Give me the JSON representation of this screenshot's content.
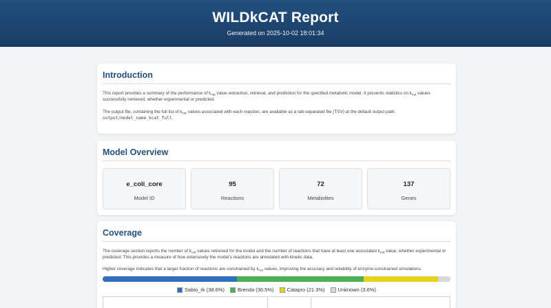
{
  "header": {
    "title": "WILDkCAT Report",
    "generated": "Generated on 2025-10-02 18:01:34"
  },
  "intro": {
    "title": "Introduction",
    "p1_a": "This report provides a summary of the performance of k",
    "p1_sub1": "cat",
    "p1_b": " value extraction, retrieval, and prediction for the specified metabolic model. It presents statistics on k",
    "p1_sub2": "cat",
    "p1_c": " values successfully retrieved, whether experimental or predicted.",
    "p2_a": "The output file, containing the full list of k",
    "p2_sub": "cat",
    "p2_b": " values associated with each reaction, are available as a tab-separated file (TSV) at the default output path: ",
    "p2_code": "output/model_name_kcat_full",
    "p2_end": "."
  },
  "overview": {
    "title": "Model Overview",
    "stats": [
      {
        "value": "e_coli_core",
        "label": "Model ID"
      },
      {
        "value": "95",
        "label": "Reactions"
      },
      {
        "value": "72",
        "label": "Metabolites"
      },
      {
        "value": "137",
        "label": "Genes"
      }
    ]
  },
  "coverage": {
    "title": "Coverage",
    "p1_a": "The coverage section reports the number of k",
    "p1_sub1": "cat",
    "p1_b": " values retrieved for the model and the number of reactions that have at least one associated k",
    "p1_sub2": "cat",
    "p1_c": " value, whether experimental or predicted. This provides a measure of how extensively the model's reactions are annotated with kinetic data.",
    "p2_a": "Higher coverage indicates that a larger fraction of reactions are constrained by k",
    "p2_sub": "cat",
    "p2_b": " values, improving the accuracy and reliability of enzyme-constrained simulations.",
    "sources": [
      {
        "name": "Sabio_rk",
        "label": "Sabio_rk (38.6%)",
        "percent": 38.6,
        "color": "#2f6fbf"
      },
      {
        "name": "Brenda",
        "label": "Brenda (36.5%)",
        "percent": 36.5,
        "color": "#4caf50"
      },
      {
        "name": "Catapro",
        "label": "Catapro (21.3%)",
        "percent": 21.3,
        "color": "#e5d21a"
      },
      {
        "name": "Unknown",
        "label": "Unknown (3.6%)",
        "percent": 3.6,
        "color": "#d9d9d9"
      }
    ]
  }
}
